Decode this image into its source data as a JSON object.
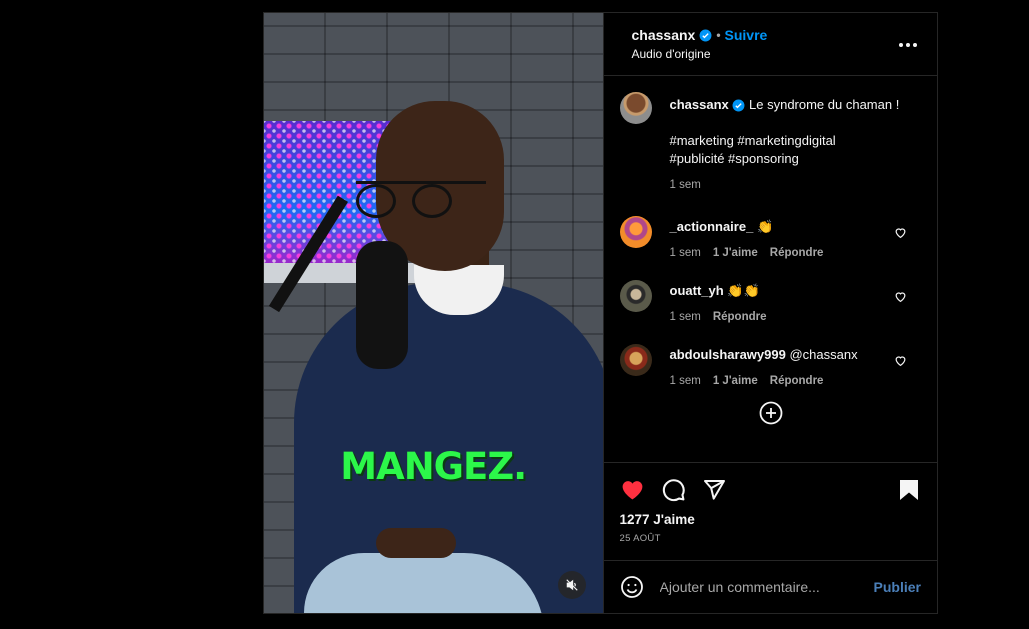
{
  "video": {
    "caption_overlay": "MANGEZ.",
    "mute_icon": "speaker-muted-icon"
  },
  "header": {
    "username": "chassanx",
    "verified": true,
    "separator": "•",
    "follow_label": "Suivre",
    "audio": "Audio d'origine",
    "more_icon": "more-options-icon"
  },
  "post": {
    "username": "chassanx",
    "caption": "Le syndrome du chaman !",
    "hashtags_line1": "#marketing #marketingdigital",
    "hashtags_line2": "#publicité #sponsoring",
    "time": "1 sem"
  },
  "comments": [
    {
      "username": "_actionnaire_",
      "text": "👏",
      "time": "1 sem",
      "likes": "1 J'aime",
      "reply": "Répondre"
    },
    {
      "username": "ouatt_yh",
      "text": "👏👏",
      "time": "1 sem",
      "likes": "",
      "reply": "Répondre"
    },
    {
      "username": "abdoulsharawy999",
      "text": "@chassanx",
      "time": "1 sem",
      "likes": "1 J'aime",
      "reply": "Répondre"
    }
  ],
  "actions": {
    "liked": true,
    "like_count": "1277 J'aime",
    "date": "25 AOÛT"
  },
  "composer": {
    "placeholder": "Ajouter un commentaire...",
    "publish_label": "Publier"
  },
  "colors": {
    "accent_blue": "#0095f6",
    "like_red": "#ff3040",
    "caption_green": "#2cf74a"
  }
}
